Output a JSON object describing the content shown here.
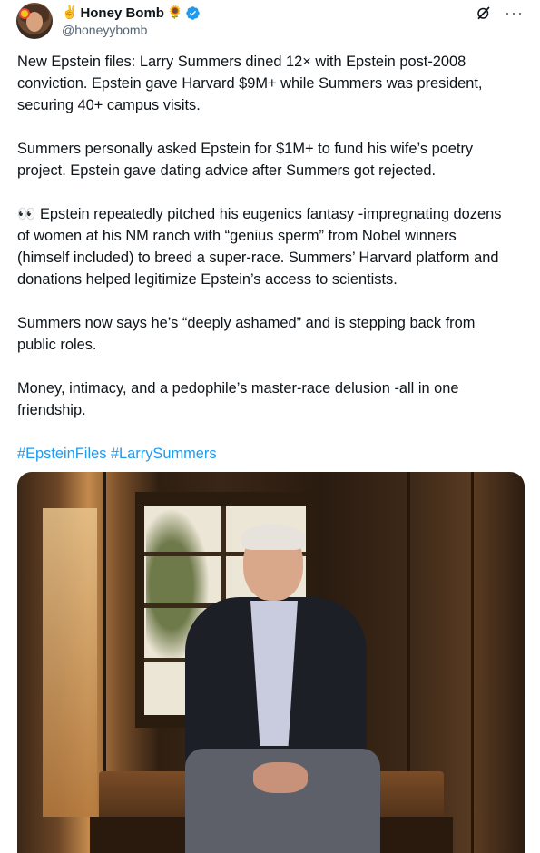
{
  "author": {
    "name_prefix_emoji": "✌️",
    "display_name": "Honey Bomb",
    "name_suffix_emoji": "🌻",
    "handle": "@honeyybomb",
    "verified": true
  },
  "actions": {
    "grok_icon": "grok-icon",
    "more_icon": "more-icon",
    "more_label": "···"
  },
  "tweet": {
    "paragraphs": [
      "New Epstein files: Larry Summers dined 12× with Epstein post-2008\nconviction. Epstein gave Harvard $9M+ while Summers was president,\nsecuring 40+ campus visits.",
      "Summers personally asked Epstein for $1M+ to fund his wife’s poetry\nproject. Epstein gave dating advice after Summers got rejected.",
      "👀 Epstein repeatedly pitched his eugenics fantasy -impregnating dozens\nof women at his NM ranch with “genius sperm” from Nobel winners\n(himself included) to breed a super-race. Summers’ Harvard platform and\ndonations helped legitimize Epstein’s access to scientists.",
      "Summers now says he’s “deeply ashamed” and is stepping back from\npublic roles.",
      "Money, intimacy, and a pedophile’s master-race delusion -all in one\nfriendship."
    ],
    "hashtags": "#EpsteinFiles #LarrySummers"
  },
  "colors": {
    "text": "#0f1419",
    "secondary": "#536471",
    "link": "#1d9bf0",
    "verified": "#1d9bf0"
  }
}
